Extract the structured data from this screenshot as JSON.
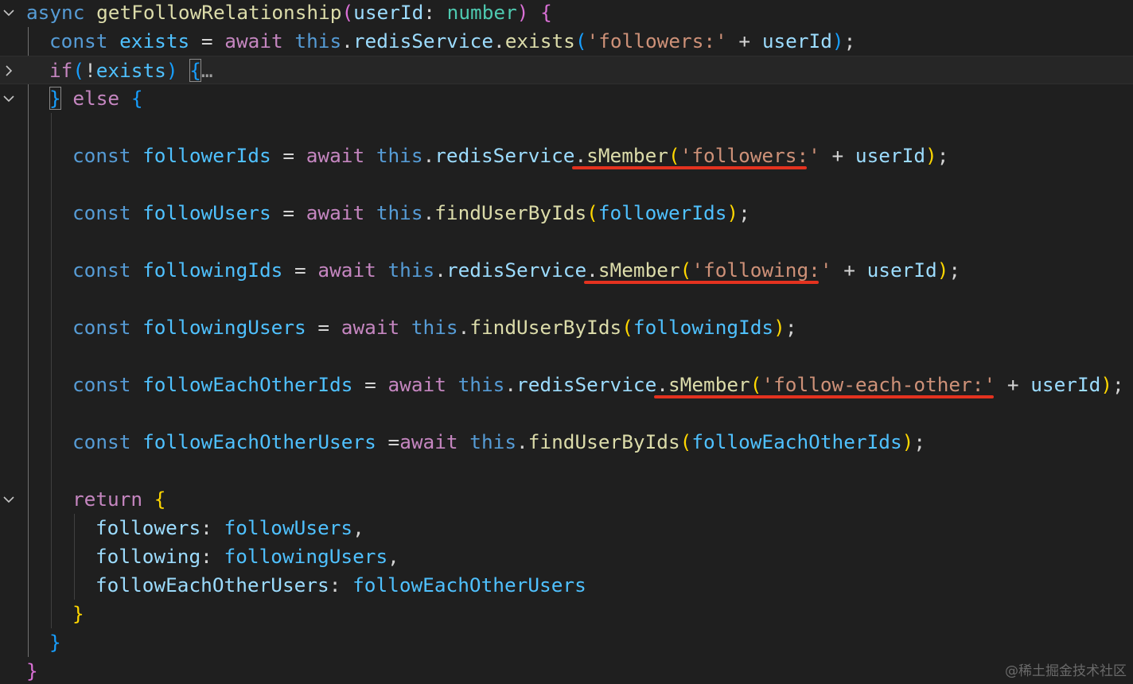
{
  "editor": {
    "current_line": 3,
    "watermark": "@稀土掘金技术社区",
    "fold_markers": [
      {
        "line": 1,
        "icon": "chevron-down-icon",
        "state": "expanded"
      },
      {
        "line": 3,
        "icon": "chevron-right-icon",
        "state": "collapsed"
      },
      {
        "line": 4,
        "icon": "chevron-down-icon",
        "state": "expanded"
      },
      {
        "line": 18,
        "icon": "chevron-down-icon",
        "state": "expanded"
      }
    ],
    "annotation_color": "#e4321f",
    "lines": [
      {
        "n": 1,
        "indent": 0,
        "tokens": [
          {
            "t": "async ",
            "c": "kw"
          },
          {
            "t": "getFollowRelationship",
            "c": "fn"
          },
          {
            "t": "(",
            "c": "b2"
          },
          {
            "t": "userId",
            "c": "var"
          },
          {
            "t": ": ",
            "c": "punc"
          },
          {
            "t": "number",
            "c": "type"
          },
          {
            "t": ")",
            "c": "b2"
          },
          {
            "t": " ",
            "c": "punc"
          },
          {
            "t": "{",
            "c": "b2"
          }
        ]
      },
      {
        "n": 2,
        "indent": 1,
        "tokens": [
          {
            "t": "const ",
            "c": "kw"
          },
          {
            "t": "exists",
            "c": "const"
          },
          {
            "t": " = ",
            "c": "op"
          },
          {
            "t": "await ",
            "c": "ctrl"
          },
          {
            "t": "this",
            "c": "kw"
          },
          {
            "t": ".",
            "c": "punc"
          },
          {
            "t": "redisService",
            "c": "var"
          },
          {
            "t": ".",
            "c": "punc"
          },
          {
            "t": "exists",
            "c": "fn"
          },
          {
            "t": "(",
            "c": "b3"
          },
          {
            "t": "'followers:'",
            "c": "str"
          },
          {
            "t": " + ",
            "c": "op"
          },
          {
            "t": "userId",
            "c": "var"
          },
          {
            "t": ")",
            "c": "b3"
          },
          {
            "t": ";",
            "c": "punc"
          }
        ]
      },
      {
        "n": 3,
        "indent": 1,
        "tokens": [
          {
            "t": "if",
            "c": "ctrl"
          },
          {
            "t": "(",
            "c": "b3"
          },
          {
            "t": "!",
            "c": "op"
          },
          {
            "t": "exists",
            "c": "const"
          },
          {
            "t": ")",
            "c": "b3"
          },
          {
            "t": " ",
            "c": "punc"
          },
          {
            "t": "{",
            "c": "b3",
            "box": true
          },
          {
            "t": "…",
            "c": "ellipsis"
          }
        ]
      },
      {
        "n": 4,
        "indent": 1,
        "tokens": [
          {
            "t": "}",
            "c": "b3",
            "box": true
          },
          {
            "t": " ",
            "c": "punc"
          },
          {
            "t": "else",
            "c": "ctrl"
          },
          {
            "t": " ",
            "c": "punc"
          },
          {
            "t": "{",
            "c": "b3"
          }
        ]
      },
      {
        "n": 5,
        "indent": 0,
        "tokens": []
      },
      {
        "n": 6,
        "indent": 2,
        "tokens": [
          {
            "t": "const ",
            "c": "kw"
          },
          {
            "t": "followerIds",
            "c": "const"
          },
          {
            "t": " = ",
            "c": "op"
          },
          {
            "t": "await ",
            "c": "ctrl"
          },
          {
            "t": "this",
            "c": "kw"
          },
          {
            "t": ".",
            "c": "punc"
          },
          {
            "t": "redisService",
            "c": "var"
          },
          {
            "t": ".",
            "c": "punc"
          },
          {
            "t": "sMember",
            "c": "fn",
            "ul_start": true
          },
          {
            "t": "(",
            "c": "b1"
          },
          {
            "t": "'followers:",
            "c": "str",
            "ul_end": true
          },
          {
            "t": "'",
            "c": "str"
          },
          {
            "t": " + ",
            "c": "op"
          },
          {
            "t": "userId",
            "c": "var"
          },
          {
            "t": ")",
            "c": "b1"
          },
          {
            "t": ";",
            "c": "punc"
          }
        ]
      },
      {
        "n": 7,
        "indent": 0,
        "tokens": []
      },
      {
        "n": 8,
        "indent": 2,
        "tokens": [
          {
            "t": "const ",
            "c": "kw"
          },
          {
            "t": "followUsers",
            "c": "const"
          },
          {
            "t": " = ",
            "c": "op"
          },
          {
            "t": "await ",
            "c": "ctrl"
          },
          {
            "t": "this",
            "c": "kw"
          },
          {
            "t": ".",
            "c": "punc"
          },
          {
            "t": "findUserByIds",
            "c": "fn"
          },
          {
            "t": "(",
            "c": "b1"
          },
          {
            "t": "followerIds",
            "c": "const"
          },
          {
            "t": ")",
            "c": "b1"
          },
          {
            "t": ";",
            "c": "punc"
          }
        ]
      },
      {
        "n": 9,
        "indent": 0,
        "tokens": []
      },
      {
        "n": 10,
        "indent": 2,
        "tokens": [
          {
            "t": "const ",
            "c": "kw"
          },
          {
            "t": "followingIds",
            "c": "const"
          },
          {
            "t": " = ",
            "c": "op"
          },
          {
            "t": "await ",
            "c": "ctrl"
          },
          {
            "t": "this",
            "c": "kw"
          },
          {
            "t": ".",
            "c": "punc"
          },
          {
            "t": "redisService",
            "c": "var"
          },
          {
            "t": ".",
            "c": "punc"
          },
          {
            "t": "sMember",
            "c": "fn",
            "ul_start": true
          },
          {
            "t": "(",
            "c": "b1"
          },
          {
            "t": "'following:",
            "c": "str",
            "ul_end": true
          },
          {
            "t": "'",
            "c": "str"
          },
          {
            "t": " + ",
            "c": "op"
          },
          {
            "t": "userId",
            "c": "var"
          },
          {
            "t": ")",
            "c": "b1"
          },
          {
            "t": ";",
            "c": "punc"
          }
        ]
      },
      {
        "n": 11,
        "indent": 0,
        "tokens": []
      },
      {
        "n": 12,
        "indent": 2,
        "tokens": [
          {
            "t": "const ",
            "c": "kw"
          },
          {
            "t": "followingUsers",
            "c": "const"
          },
          {
            "t": " = ",
            "c": "op"
          },
          {
            "t": "await ",
            "c": "ctrl"
          },
          {
            "t": "this",
            "c": "kw"
          },
          {
            "t": ".",
            "c": "punc"
          },
          {
            "t": "findUserByIds",
            "c": "fn"
          },
          {
            "t": "(",
            "c": "b1"
          },
          {
            "t": "followingIds",
            "c": "const"
          },
          {
            "t": ")",
            "c": "b1"
          },
          {
            "t": ";",
            "c": "punc"
          }
        ]
      },
      {
        "n": 13,
        "indent": 0,
        "tokens": []
      },
      {
        "n": 14,
        "indent": 2,
        "tokens": [
          {
            "t": "const ",
            "c": "kw"
          },
          {
            "t": "followEachOtherIds",
            "c": "const"
          },
          {
            "t": " = ",
            "c": "op"
          },
          {
            "t": "await ",
            "c": "ctrl"
          },
          {
            "t": "this",
            "c": "kw"
          },
          {
            "t": ".",
            "c": "punc"
          },
          {
            "t": "redisService",
            "c": "var"
          },
          {
            "t": ".",
            "c": "punc"
          },
          {
            "t": "sMember",
            "c": "fn",
            "ul_start": true
          },
          {
            "t": "(",
            "c": "b1"
          },
          {
            "t": "'follow-each-other:'",
            "c": "str",
            "ul_end": true
          },
          {
            "t": " + ",
            "c": "op"
          },
          {
            "t": "userId",
            "c": "var"
          },
          {
            "t": ")",
            "c": "b1"
          },
          {
            "t": ";",
            "c": "punc"
          }
        ]
      },
      {
        "n": 15,
        "indent": 0,
        "tokens": []
      },
      {
        "n": 16,
        "indent": 2,
        "tokens": [
          {
            "t": "const ",
            "c": "kw"
          },
          {
            "t": "followEachOtherUsers",
            "c": "const"
          },
          {
            "t": " =",
            "c": "op"
          },
          {
            "t": "await ",
            "c": "ctrl"
          },
          {
            "t": "this",
            "c": "kw"
          },
          {
            "t": ".",
            "c": "punc"
          },
          {
            "t": "findUserByIds",
            "c": "fn"
          },
          {
            "t": "(",
            "c": "b1"
          },
          {
            "t": "followEachOtherIds",
            "c": "const"
          },
          {
            "t": ")",
            "c": "b1"
          },
          {
            "t": ";",
            "c": "punc"
          }
        ]
      },
      {
        "n": 17,
        "indent": 0,
        "tokens": []
      },
      {
        "n": 18,
        "indent": 2,
        "tokens": [
          {
            "t": "return ",
            "c": "ctrl"
          },
          {
            "t": "{",
            "c": "b1"
          }
        ]
      },
      {
        "n": 19,
        "indent": 3,
        "tokens": [
          {
            "t": "followers",
            "c": "var"
          },
          {
            "t": ": ",
            "c": "punc"
          },
          {
            "t": "followUsers",
            "c": "const"
          },
          {
            "t": ",",
            "c": "punc"
          }
        ]
      },
      {
        "n": 20,
        "indent": 3,
        "tokens": [
          {
            "t": "following",
            "c": "var"
          },
          {
            "t": ": ",
            "c": "punc"
          },
          {
            "t": "followingUsers",
            "c": "const"
          },
          {
            "t": ",",
            "c": "punc"
          }
        ]
      },
      {
        "n": 21,
        "indent": 3,
        "tokens": [
          {
            "t": "followEachOtherUsers",
            "c": "var"
          },
          {
            "t": ": ",
            "c": "punc"
          },
          {
            "t": "followEachOtherUsers",
            "c": "const"
          }
        ]
      },
      {
        "n": 22,
        "indent": 2,
        "tokens": [
          {
            "t": "}",
            "c": "b1"
          }
        ]
      },
      {
        "n": 23,
        "indent": 1,
        "tokens": [
          {
            "t": "}",
            "c": "b3"
          }
        ]
      },
      {
        "n": 24,
        "indent": 0,
        "tokens": [
          {
            "t": "}",
            "c": "b2"
          }
        ]
      }
    ]
  }
}
